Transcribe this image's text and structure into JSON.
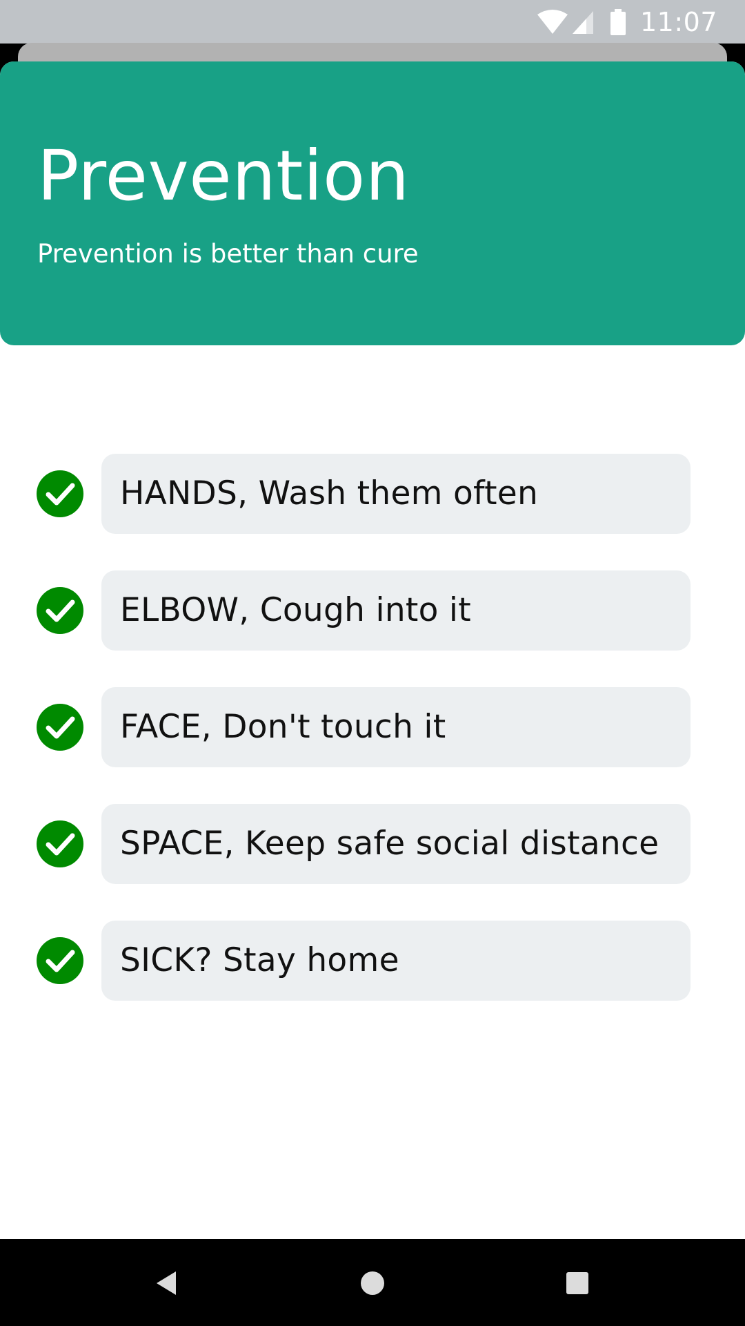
{
  "status_bar": {
    "time": "11:07",
    "icons": [
      "wifi-icon",
      "signal-icon",
      "battery-icon"
    ]
  },
  "header": {
    "title": "Prevention",
    "subtitle": "Prevention is better than cure",
    "background_color": "#18a186"
  },
  "tips": [
    {
      "text": "HANDS, Wash them often",
      "icon": "check-circle-icon"
    },
    {
      "text": "ELBOW, Cough into it",
      "icon": "check-circle-icon"
    },
    {
      "text": "FACE, Don't touch it",
      "icon": "check-circle-icon"
    },
    {
      "text": "SPACE, Keep safe social distance",
      "icon": "check-circle-icon"
    },
    {
      "text": "SICK? Stay home",
      "icon": "check-circle-icon"
    }
  ],
  "colors": {
    "check": "#008a00",
    "tip_background": "#eceff1",
    "status_bar": "#bfc3c7"
  },
  "nav_bar": {
    "buttons": [
      "back-icon",
      "home-icon",
      "recents-icon"
    ]
  }
}
